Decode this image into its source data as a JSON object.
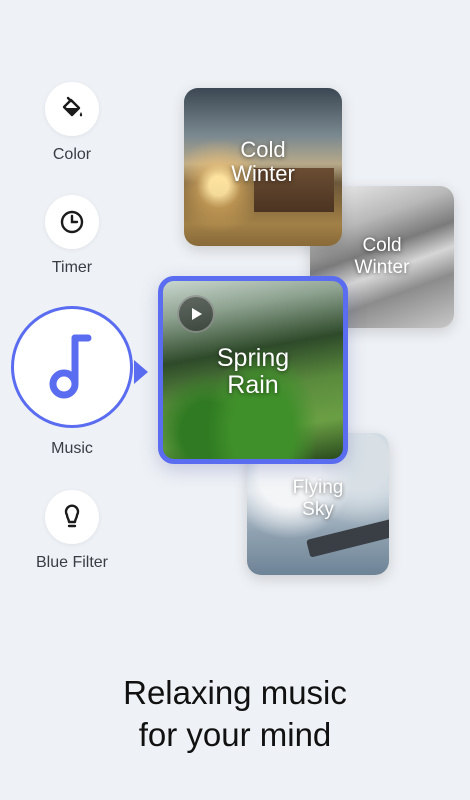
{
  "features": {
    "color": {
      "label": "Color",
      "icon": "paint-bucket-icon"
    },
    "timer": {
      "label": "Timer",
      "icon": "clock-icon"
    },
    "music": {
      "label": "Music",
      "icon": "music-note-icon",
      "selected": true
    },
    "blue_filter": {
      "label": "Blue Filter",
      "icon": "lightbulb-icon"
    }
  },
  "cards": {
    "cold_winter_1": {
      "title": "Cold\nWinter"
    },
    "cold_winter_2": {
      "title": "Cold\nWinter"
    },
    "spring_rain": {
      "title": "Spring\nRain",
      "playing": false
    },
    "flying_sky": {
      "title": "Flying\nSky"
    }
  },
  "headline": {
    "line1": "Relaxing music",
    "line2": "for your mind"
  },
  "colors": {
    "accent": "#5a6cf0",
    "background": "#eef1f5",
    "text": "#111111"
  }
}
